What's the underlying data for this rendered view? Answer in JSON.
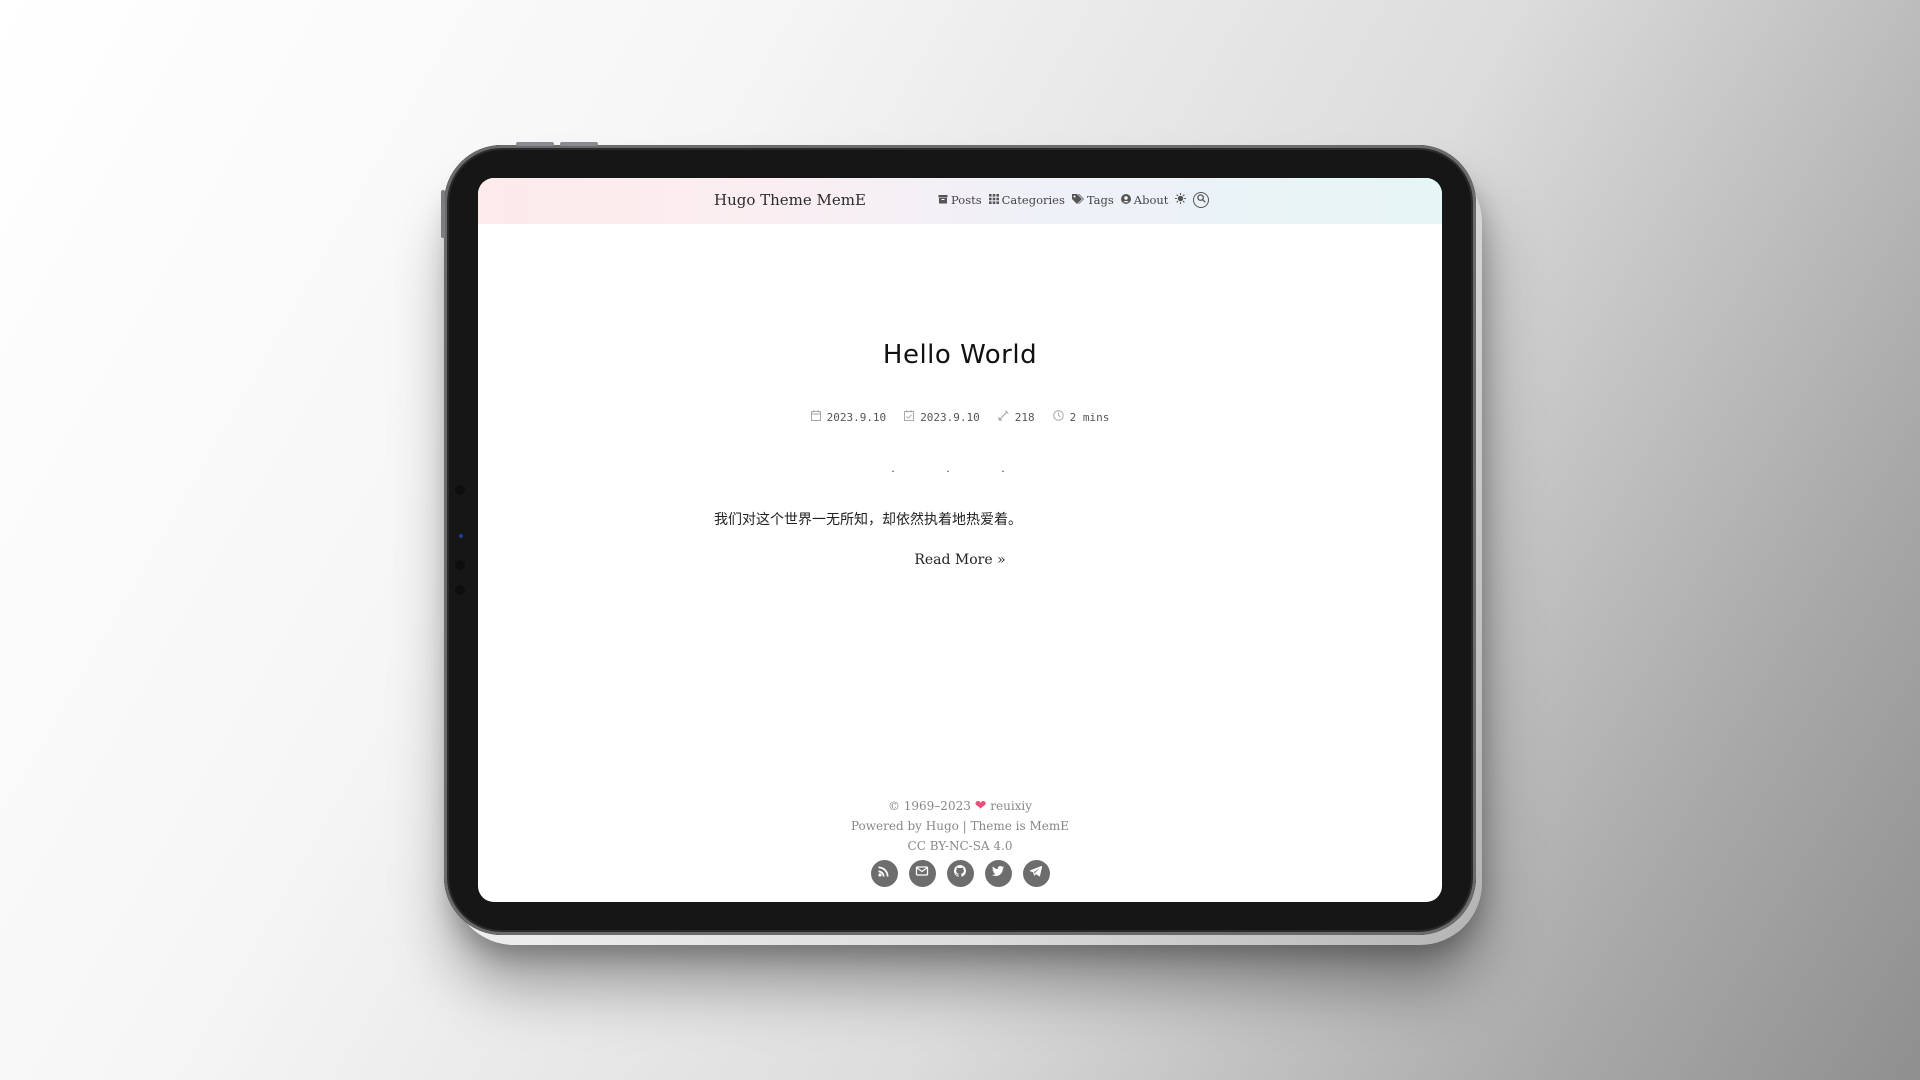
{
  "header": {
    "site_title": "Hugo Theme MemE",
    "nav": [
      {
        "label": "Posts",
        "icon": "archive-icon"
      },
      {
        "label": "Categories",
        "icon": "grid-icon"
      },
      {
        "label": "Tags",
        "icon": "tags-icon"
      },
      {
        "label": "About",
        "icon": "user-circle-icon"
      }
    ],
    "theme_toggle_icon": "sun-icon",
    "search_icon": "search-icon"
  },
  "post": {
    "title": "Hello World",
    "published": "2023.9.10",
    "updated": "2023.9.10",
    "word_count": "218",
    "read_time": "2 mins",
    "divider": "· · ·",
    "excerpt": "我们对这个世界一无所知，却依然执着地热爱着。",
    "read_more": "Read More »"
  },
  "footer": {
    "copyright_prefix": "© 1969–2023",
    "author": "reuixiy",
    "powered": "Powered by Hugo | Theme is MemE",
    "license": "CC BY-NC-SA 4.0",
    "social": [
      "rss-icon",
      "mail-icon",
      "github-icon",
      "twitter-icon",
      "telegram-icon"
    ]
  },
  "colors": {
    "heart": "#e8507a",
    "social_bg": "#6d6d6d"
  }
}
